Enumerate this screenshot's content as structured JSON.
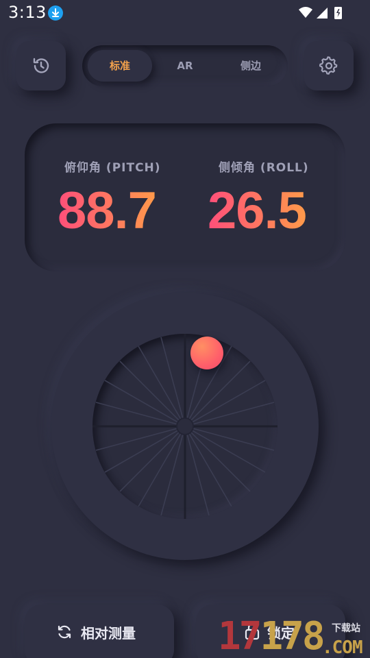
{
  "status_bar": {
    "time": "3:13"
  },
  "mode_tabs": [
    {
      "label": "标准",
      "selected": true
    },
    {
      "label": "AR",
      "selected": false
    },
    {
      "label": "侧边",
      "selected": false
    }
  ],
  "angles": {
    "pitch_label": "俯仰角 (PITCH)",
    "pitch_value": "88.7",
    "roll_label": "侧倾角 (ROLL)",
    "roll_value": "26.5"
  },
  "actions": {
    "relative_label": "相对测量",
    "lock_label": "锁定"
  },
  "watermark": {
    "digits_a": "17",
    "digits_b": "178",
    "cn": "下载站",
    "com": ".COM"
  },
  "colors": {
    "background": "#2e2f41",
    "accent_orange": "#f3a24c",
    "value_gradient_start": "#ff4f7a",
    "value_gradient_end": "#ff9a4a"
  },
  "icons": {
    "history": "history-icon",
    "settings": "gear-icon",
    "relative": "refresh-icon",
    "lock": "lock-icon"
  }
}
